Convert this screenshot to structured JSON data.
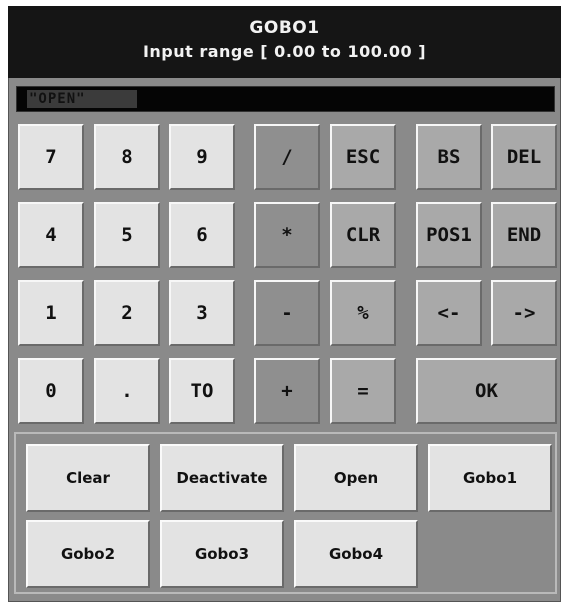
{
  "header": {
    "title": "GOBO1",
    "range": "Input range [  0.00  to  100.00  ]"
  },
  "input": {
    "value": "\"OPEN\""
  },
  "keypad": {
    "k7": "7",
    "k8": "8",
    "k9": "9",
    "k4": "4",
    "k5": "5",
    "k6": "6",
    "k1": "1",
    "k2": "2",
    "k3": "3",
    "k0": "0",
    "dot": ".",
    "to": "TO",
    "div": "/",
    "mul": "*",
    "minus": "-",
    "plus": "+",
    "esc": "ESC",
    "clr": "CLR",
    "pct": "%",
    "eq": "=",
    "bs": "BS",
    "del": "DEL",
    "pos1": "POS1",
    "end": "END",
    "left": "<-",
    "right": "->",
    "ok": "OK"
  },
  "presets": {
    "clear": "Clear",
    "deactivate": "Deactivate",
    "open": "Open",
    "gobo1": "Gobo1",
    "gobo2": "Gobo2",
    "gobo3": "Gobo3",
    "gobo4": "Gobo4"
  },
  "colors": {
    "header_bg": "#151515",
    "panel_bg": "#8a8a8a",
    "key_light": "#e3e3e3",
    "key_mid": "#a9a9a9",
    "key_dark": "#8f8f8f"
  }
}
